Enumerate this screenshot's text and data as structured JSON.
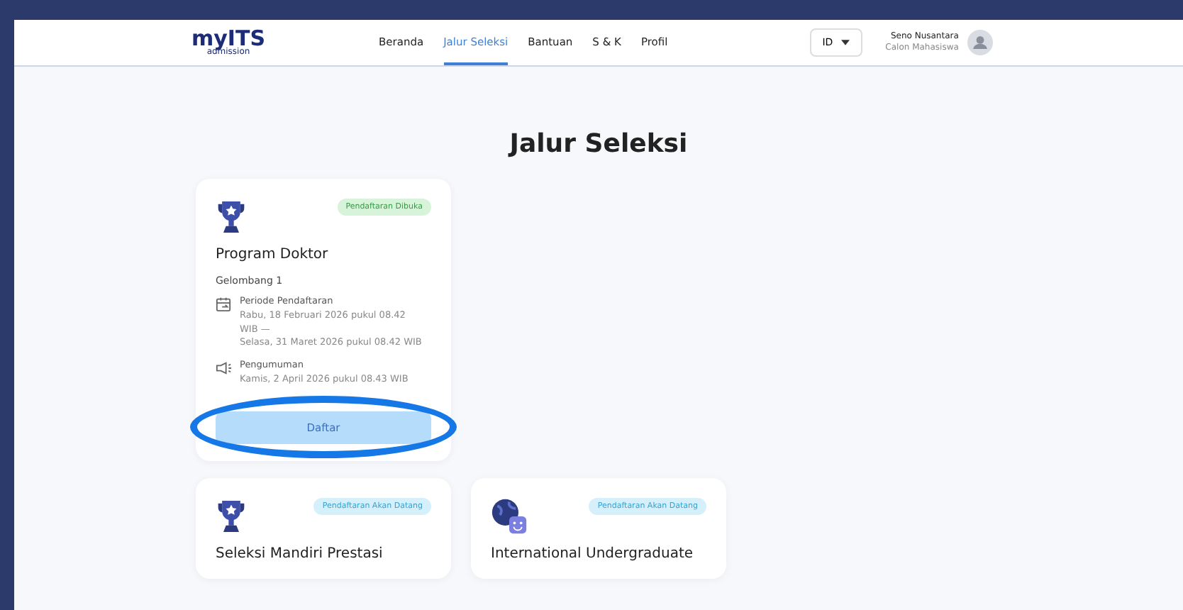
{
  "header": {
    "logo": {
      "brand": "myITS",
      "sub": "admission"
    },
    "nav": [
      {
        "label": "Beranda",
        "selected": false
      },
      {
        "label": "Jalur Seleksi",
        "selected": true
      },
      {
        "label": "Bantuan",
        "selected": false
      },
      {
        "label": "S & K",
        "selected": false
      },
      {
        "label": "Profil",
        "selected": false
      }
    ],
    "language": "ID",
    "user": {
      "name": "Seno Nusantara",
      "role": "Calon Mahasiswa"
    }
  },
  "page_title": "Jalur Seleksi",
  "cards": [
    {
      "kind": "trophy",
      "status": {
        "kind": "open",
        "label": "Pendaftaran Dibuka"
      },
      "title": "Program Doktor",
      "wave": "Gelombang 1",
      "period": {
        "label": "Periode Pendaftaran",
        "lines": [
          "Rabu, 18 Februari 2026 pukul 08.42",
          "WIB —",
          "Selasa, 31 Maret 2026 pukul 08.42 WIB"
        ]
      },
      "announcement": {
        "label": "Pengumuman",
        "date": "Kamis, 2 April 2026 pukul 08.43 WIB"
      },
      "button": "Daftar",
      "highlighted": true
    },
    {
      "kind": "trophy",
      "status": {
        "kind": "upcoming",
        "label": "Pendaftaran Akan Datang"
      },
      "title": "Seleksi Mandiri Prestasi"
    },
    {
      "kind": "globe",
      "status": {
        "kind": "upcoming",
        "label": "Pendaftaran Akan Datang"
      },
      "title": "International Undergraduate"
    }
  ]
}
